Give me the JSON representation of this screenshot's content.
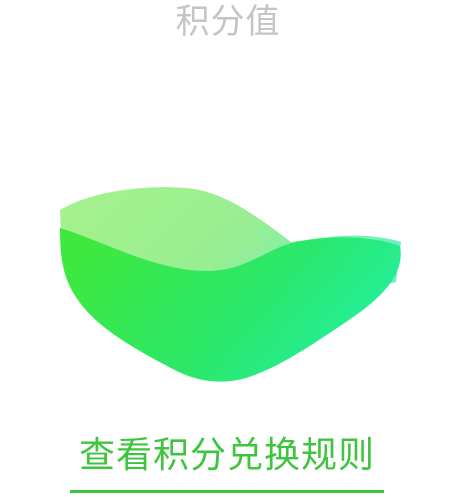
{
  "page": {
    "title": "积分值",
    "rules_link": "查看积分兑换规则"
  },
  "illustration": {
    "icon": "leaf-wave-icon",
    "colors": {
      "front_start": "#3ee83e",
      "front_end": "#22f0a6",
      "back_start": "#9ff08a",
      "back_end": "#6cf0c3"
    }
  },
  "theme": {
    "title_color": "#c4c4c4",
    "link_color": "#3fc43f"
  }
}
